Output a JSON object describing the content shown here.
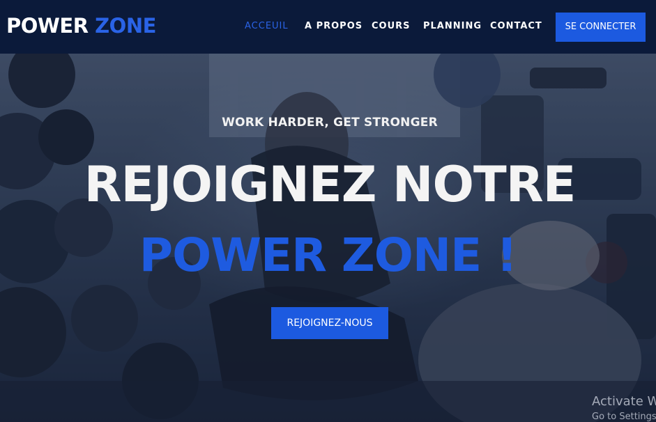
{
  "brand": {
    "word1": "POWER",
    "word2": "ZONE"
  },
  "nav": {
    "items": [
      {
        "label": "ACCEUIL",
        "active": true
      },
      {
        "label": "A PROPOS",
        "active": false
      },
      {
        "label": "COURS",
        "active": false
      },
      {
        "label": "PLANNING",
        "active": false
      },
      {
        "label": "CONTACT",
        "active": false
      }
    ],
    "login_label": "SE CONNECTER"
  },
  "hero": {
    "tagline": "WORK HARDER, GET STRONGER",
    "headline": "REJOIGNEZ NOTRE",
    "headline_brand": "POWER ZONE !",
    "cta_label": "REJOIGNEZ-NOUS",
    "background_icon": "gym-photo"
  },
  "watermark": {
    "line1": "Activate W",
    "line2": "Go to Settings"
  },
  "colors": {
    "navbar_bg": "#0b1a3a",
    "accent": "#1c5ae0",
    "text_light": "#f4f4f4"
  }
}
